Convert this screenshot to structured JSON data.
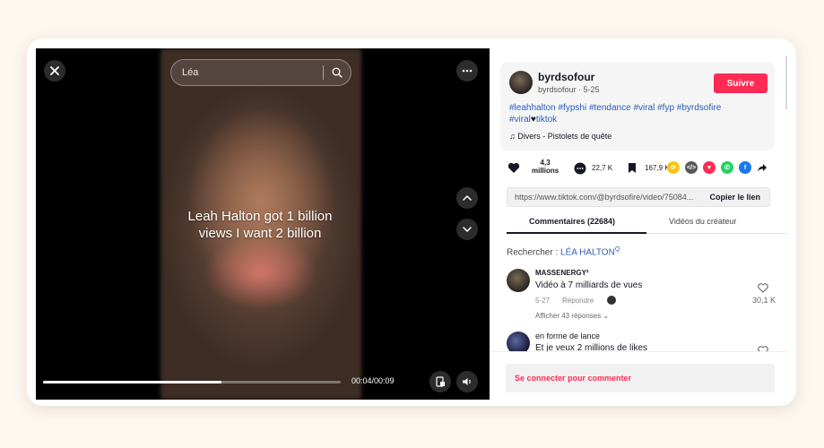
{
  "video": {
    "search_query": "Léa",
    "caption_line1": "Leah Halton got 1 billion",
    "caption_line2": "views I want 2 billion",
    "time": "00:04/00:09",
    "progress": 0.6
  },
  "author": {
    "name": "byrdsofour",
    "handle_date": "byrdsofour · 5-25",
    "follow_label": "Suivre",
    "hashtags_line1": "#leahhalton #fypshi #tendance #viral #fyp #byrdsofire",
    "hashtags_line2_a": "#viral",
    "hashtags_line2_b": "tiktok",
    "music": "Divers - Pistolets de quête"
  },
  "actions": {
    "likes": "4,3 millions",
    "likes_line1": "4,3",
    "likes_line2": "millions",
    "comments": "22,7 K",
    "saves": "167,9 K"
  },
  "link": {
    "url": "https://www.tiktok.com/@byrdsofire/video/75084...",
    "copy_label": "Copier le lien"
  },
  "tabs": {
    "comments": "Commentaires (22684)",
    "creator_videos": "Vidéos du créateur"
  },
  "search": {
    "prefix": "Rechercher : ",
    "term": "LÉA HALTON",
    "suffix": "Q"
  },
  "comments": [
    {
      "user": "MASSENERGY²",
      "text": "Vidéo à 7 milliards de vues",
      "date": "5-27",
      "reply_label": "Répondre",
      "likes": "30,1 K",
      "more": "Afficher 43 réponses"
    },
    {
      "user": "en forme de lance",
      "text": "Et je veux 2 millions de likes"
    }
  ],
  "login_label": "Se connecter pour commenter",
  "colors": {
    "accent": "#fe2c55",
    "hashtag": "#2b5db9",
    "background": "#fdf7ef"
  }
}
